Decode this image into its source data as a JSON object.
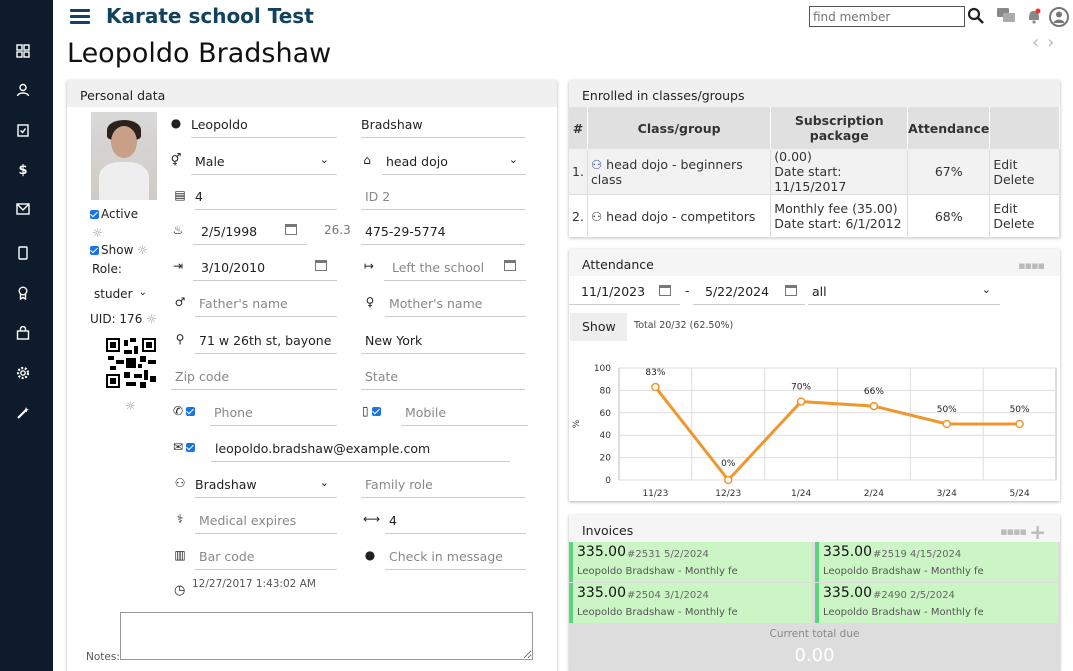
{
  "app": {
    "title": "Karate school Test",
    "search_placeholder": "find member"
  },
  "member": {
    "name": "Leopoldo Bradshaw"
  },
  "personal": {
    "header": "Personal data",
    "active_label": "Active",
    "show_label": "Show",
    "role_label": "Role:",
    "role_value": "studer",
    "uid_label": "UID: 176",
    "first_name": "Leopoldo",
    "last_name": "Bradshaw",
    "gender": "Male",
    "home_dojo": "head dojo",
    "id1": "4",
    "id2_placeholder": "ID 2",
    "birthdate": "2/5/1998",
    "age": "26.3",
    "ssn": "475-29-5774",
    "joined": "3/10/2010",
    "left_placeholder": "Left the school",
    "father_placeholder": "Father's name",
    "mother_placeholder": "Mother's name",
    "address": "71 w 26th st, bayone",
    "city": "New York",
    "zip_placeholder": "Zip code",
    "state_placeholder": "State",
    "phone_placeholder": "Phone",
    "mobile_placeholder": "Mobile",
    "email": "leopoldo.bradshaw@example.com",
    "family": "Bradshaw",
    "family_role_placeholder": "Family role",
    "medical_placeholder": "Medical expires",
    "belt_value": "4",
    "barcode_placeholder": "Bar code",
    "checkin_placeholder": "Check in message",
    "created": "12/27/2017 1:43:02 AM",
    "notes_label": "Notes:"
  },
  "enrolled": {
    "header": "Enrolled in classes/groups",
    "columns": [
      "#",
      "Class/group",
      "Subscription package",
      "Attendance",
      ""
    ],
    "rows": [
      {
        "num": "1.",
        "group": "head dojo - beginners class",
        "package": "(0.00)",
        "start": "Date start: 11/15/2017",
        "attendance": "67%",
        "actions": "Edit Delete"
      },
      {
        "num": "2.",
        "group": "head dojo - competitors",
        "package": "Monthly fee (35.00)",
        "start": "Date start: 6/1/2012",
        "attendance": "68%",
        "actions": "Edit Delete"
      }
    ]
  },
  "attendance": {
    "header": "Attendance",
    "date_from": "11/1/2023",
    "separator": "-",
    "date_to": "5/22/2024",
    "filter": "all",
    "show_label": "Show",
    "total": "Total 20/32 (62.50%)"
  },
  "chart_data": {
    "type": "line",
    "categories": [
      "11/23",
      "12/23",
      "1/24",
      "2/24",
      "3/24",
      "5/24"
    ],
    "values": [
      83,
      0,
      70,
      66,
      50,
      50
    ],
    "data_labels": [
      "83%",
      "0%",
      "70%",
      "66%",
      "50%",
      "50%"
    ],
    "ylabel": "%",
    "ylim": [
      0,
      100
    ],
    "yticks": [
      "0",
      "20",
      "40",
      "60",
      "80",
      "100"
    ],
    "grid": true,
    "color": "#f0962e"
  },
  "invoices": {
    "header": "Invoices",
    "items": [
      {
        "amount": "335.00",
        "meta": "#2531 5/2/2024",
        "who": "Leopoldo Bradshaw - Monthly fe"
      },
      {
        "amount": "335.00",
        "meta": "#2519 4/15/2024",
        "who": "Leopoldo Bradshaw - Monthly fe"
      },
      {
        "amount": "335.00",
        "meta": "#2504 3/1/2024",
        "who": "Leopoldo Bradshaw - Monthly fe"
      },
      {
        "amount": "335.00",
        "meta": "#2490 2/5/2024",
        "who": "Leopoldo Bradshaw - Monthly fe"
      }
    ],
    "total_label": "Current total due",
    "total_value": "0.00"
  },
  "colors": {
    "sidebar": "#0d1b2a",
    "title": "#13425e",
    "accent_blue": "#1a73e8",
    "invoice_green": "#ccf5c6",
    "chart_line": "#f0962e"
  }
}
